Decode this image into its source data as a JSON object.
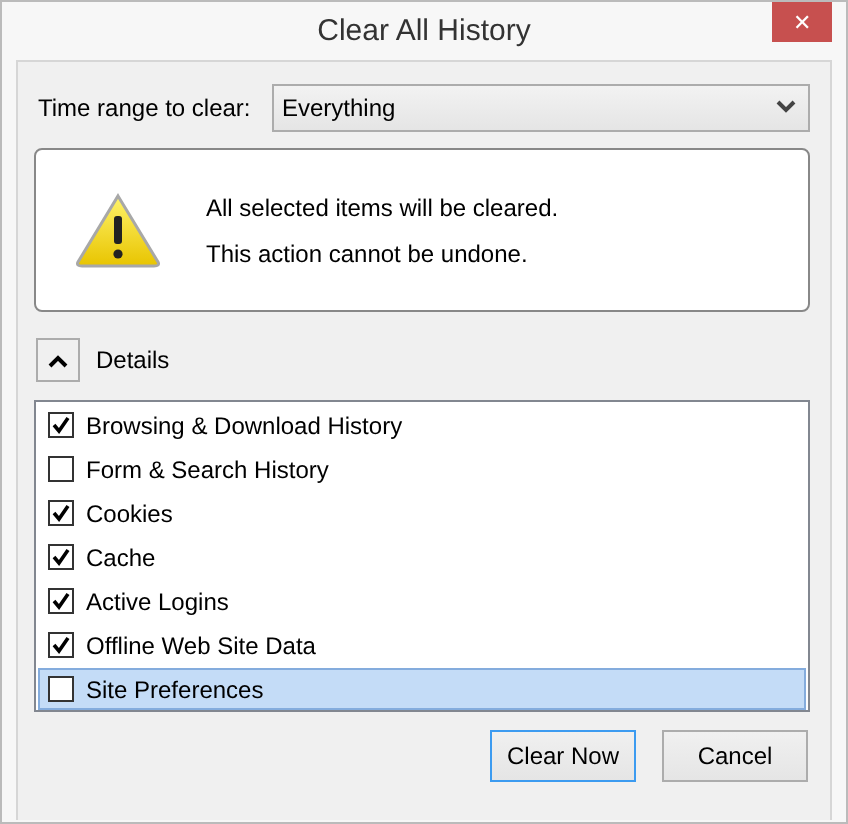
{
  "window": {
    "title": "Clear All History",
    "close": "✕"
  },
  "time_range": {
    "label": "Time range to clear:",
    "value": "Everything"
  },
  "warning": {
    "lines": [
      "All selected items will be cleared.",
      "This action cannot be undone."
    ]
  },
  "details": {
    "label": "Details",
    "expanded": true
  },
  "items": [
    {
      "label": "Browsing & Download History",
      "checked": true,
      "selected": false
    },
    {
      "label": "Form & Search History",
      "checked": false,
      "selected": false
    },
    {
      "label": "Cookies",
      "checked": true,
      "selected": false
    },
    {
      "label": "Cache",
      "checked": true,
      "selected": false
    },
    {
      "label": "Active Logins",
      "checked": true,
      "selected": false
    },
    {
      "label": "Offline Web Site Data",
      "checked": true,
      "selected": false
    },
    {
      "label": "Site Preferences",
      "checked": false,
      "selected": true
    }
  ],
  "buttons": [
    {
      "label": "Clear Now",
      "default": true
    },
    {
      "label": "Cancel",
      "default": false
    }
  ]
}
